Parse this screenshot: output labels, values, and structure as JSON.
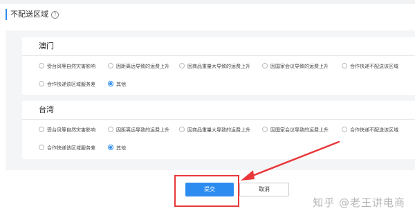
{
  "section": {
    "title": "不配送区域"
  },
  "regions": [
    {
      "name": "澳门",
      "options": [
        {
          "label": "受台风等自然灾害影响",
          "checked": false
        },
        {
          "label": "因距离远导致的运费上升",
          "checked": false
        },
        {
          "label": "因商品重量大导致的运费上升",
          "checked": false
        },
        {
          "label": "因国家会议导致的运费上升",
          "checked": false
        },
        {
          "label": "合作快递不配送该区域",
          "checked": false
        },
        {
          "label": "合作快递该区域服务差",
          "checked": false
        },
        {
          "label": "其他",
          "checked": true
        }
      ]
    },
    {
      "name": "台湾",
      "options": [
        {
          "label": "受台风等自然灾害影响",
          "checked": false
        },
        {
          "label": "因距离远导致的运费上升",
          "checked": false
        },
        {
          "label": "因商品重量大导致的运费上升",
          "checked": false
        },
        {
          "label": "因国家会议导致的运费上升",
          "checked": false
        },
        {
          "label": "合作快递不配送该区域",
          "checked": false
        },
        {
          "label": "合作快递该区域服务差",
          "checked": false
        },
        {
          "label": "其他",
          "checked": true
        }
      ]
    }
  ],
  "actions": {
    "submit_label": "提交",
    "cancel_label": "取消"
  },
  "watermark": {
    "text": "知乎 @老王讲电商"
  },
  "colors": {
    "accent": "#2d8cf0",
    "highlight": "#e8383a",
    "panel_bg": "#f4f5f7"
  }
}
